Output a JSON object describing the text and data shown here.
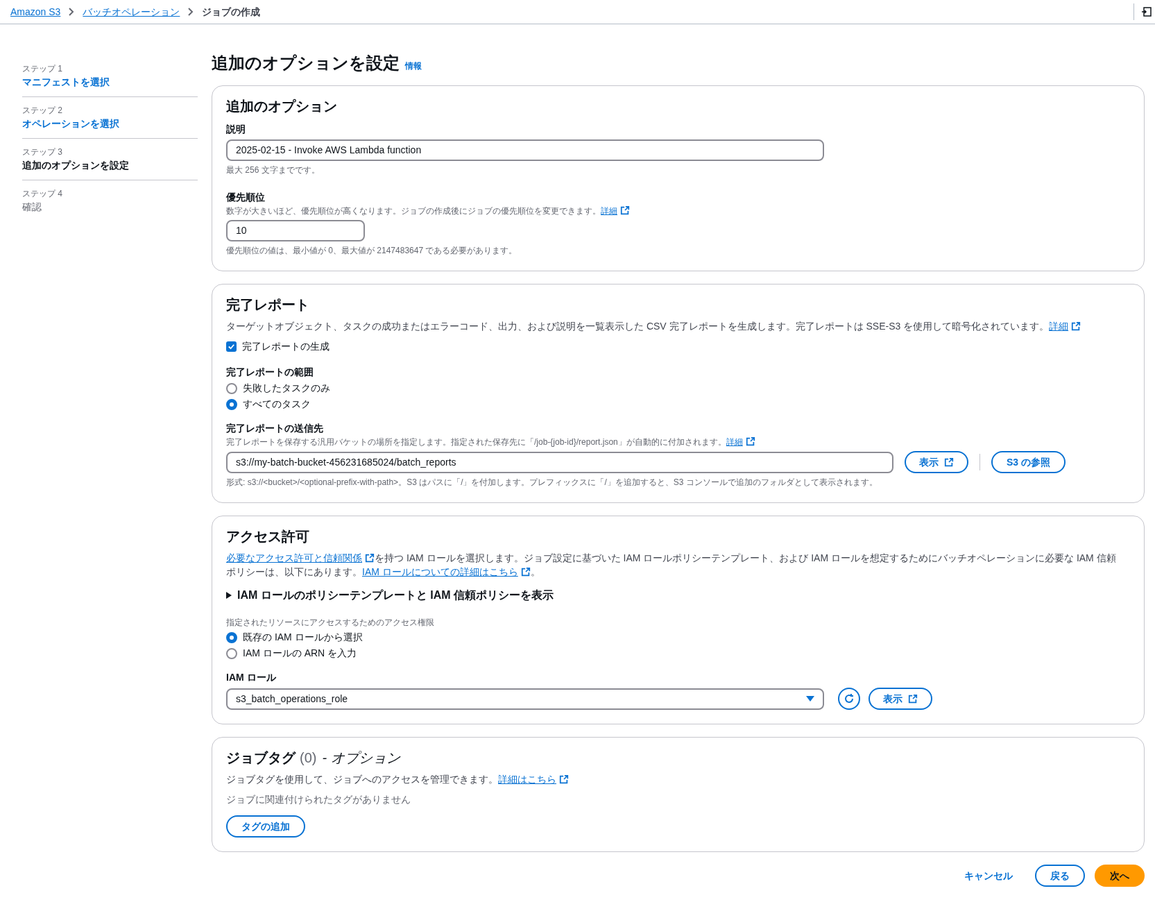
{
  "breadcrumbs": [
    {
      "label": "Amazon S3",
      "kind": "link"
    },
    {
      "label": "バッチオペレーション",
      "kind": "link"
    },
    {
      "label": "ジョブの作成",
      "kind": "current"
    }
  ],
  "steps": [
    {
      "step": "ステップ 1",
      "label": "マニフェストを選択",
      "done": true,
      "selected": false
    },
    {
      "step": "ステップ 2",
      "label": "オペレーションを選択",
      "done": true,
      "selected": false
    },
    {
      "step": "ステップ 3",
      "label": "追加のオプションを設定",
      "done": false,
      "selected": true
    },
    {
      "step": "ステップ 4",
      "label": "確認",
      "done": false,
      "selected": false
    }
  ],
  "page_title": "追加のオプションを設定",
  "info_link": "情報",
  "options": {
    "title": "追加のオプション",
    "description": {
      "label": "説明",
      "value": "2025-02-15 - Invoke AWS Lambda function",
      "hint": "最大 256 文字までです。"
    },
    "priority": {
      "label": "優先順位",
      "help": [
        {
          "kind": "text",
          "text": "数字が大きいほど、優先順位が高くなります。ジョブの作成後にジョブの優先順位を変更できます。"
        },
        {
          "kind": "link",
          "text": "詳細"
        }
      ],
      "value": "10",
      "hint": "優先順位の値は、最小値が 0、最大値が 2147483647 である必要があります。"
    }
  },
  "report": {
    "title": "完了レポート",
    "intro": [
      {
        "kind": "text",
        "text": "ターゲットオブジェクト、タスクの成功またはエラーコード、出力、および説明を一覧表示した CSV 完了レポートを生成します。完了レポートは SSE-S3 を使用して暗号化されています。"
      },
      {
        "kind": "link",
        "text": "詳細"
      }
    ],
    "generate": {
      "label": "完了レポートの生成",
      "checked": true
    },
    "scope": {
      "label": "完了レポートの範囲",
      "options": [
        {
          "label": "失敗したタスクのみ",
          "selected": false
        },
        {
          "label": "すべてのタスク",
          "selected": true
        }
      ]
    },
    "destination": {
      "label": "完了レポートの送信先",
      "help": [
        {
          "kind": "text",
          "text": "完了レポートを保存する汎用バケットの場所を指定します。指定された保存先に「/job-{job-id}/report.json」が自動的に付加されます。"
        },
        {
          "kind": "link",
          "text": "詳細"
        }
      ],
      "value": "s3://my-batch-bucket-456231685024/batch_reports",
      "view_button": "表示",
      "browse_button": "S3 の参照",
      "hint": "形式: s3://<bucket>/<optional-prefix-with-path>。S3 はパスに「/」を付加します。プレフィックスに「/」を追加すると、S3 コンソールで追加のフォルダとして表示されます。"
    }
  },
  "access": {
    "title": "アクセス許可",
    "intro": [
      {
        "kind": "link",
        "text": "必要なアクセス許可と信頼関係"
      },
      {
        "kind": "text",
        "text": "を持つ IAM ロールを選択します。ジョブ設定に基づいた IAM ロールポリシーテンプレート、および IAM ロールを想定するためにバッチオペレーションに必要な IAM 信頼ポリシーは、以下にあります。"
      },
      {
        "kind": "link",
        "text": "IAM ロールについての詳細はこちら"
      },
      {
        "kind": "text",
        "text": "。"
      }
    ],
    "expander": {
      "label": "IAM ロールのポリシーテンプレートと IAM 信頼ポリシーを表示",
      "expanded": false
    },
    "method": {
      "label": "指定されたリソースにアクセスするためのアクセス権限",
      "options": [
        {
          "label": "既存の IAM ロールから選択",
          "selected": true
        },
        {
          "label": "IAM ロールの ARN を入力",
          "selected": false
        }
      ]
    },
    "role": {
      "label": "IAM ロール",
      "value": "s3_batch_operations_role",
      "view_button": "表示"
    }
  },
  "tags": {
    "title": "ジョブタグ",
    "count": "(0)",
    "suffix": "- オプション",
    "intro": [
      {
        "kind": "text",
        "text": "ジョブタグを使用して、ジョブへのアクセスを管理できます。"
      },
      {
        "kind": "link",
        "text": "詳細はこちら"
      }
    ],
    "empty": "ジョブに関連付けられたタグがありません",
    "add_button": "タグの追加"
  },
  "footer": {
    "cancel": "キャンセル",
    "back": "戻る",
    "next": "次へ"
  }
}
